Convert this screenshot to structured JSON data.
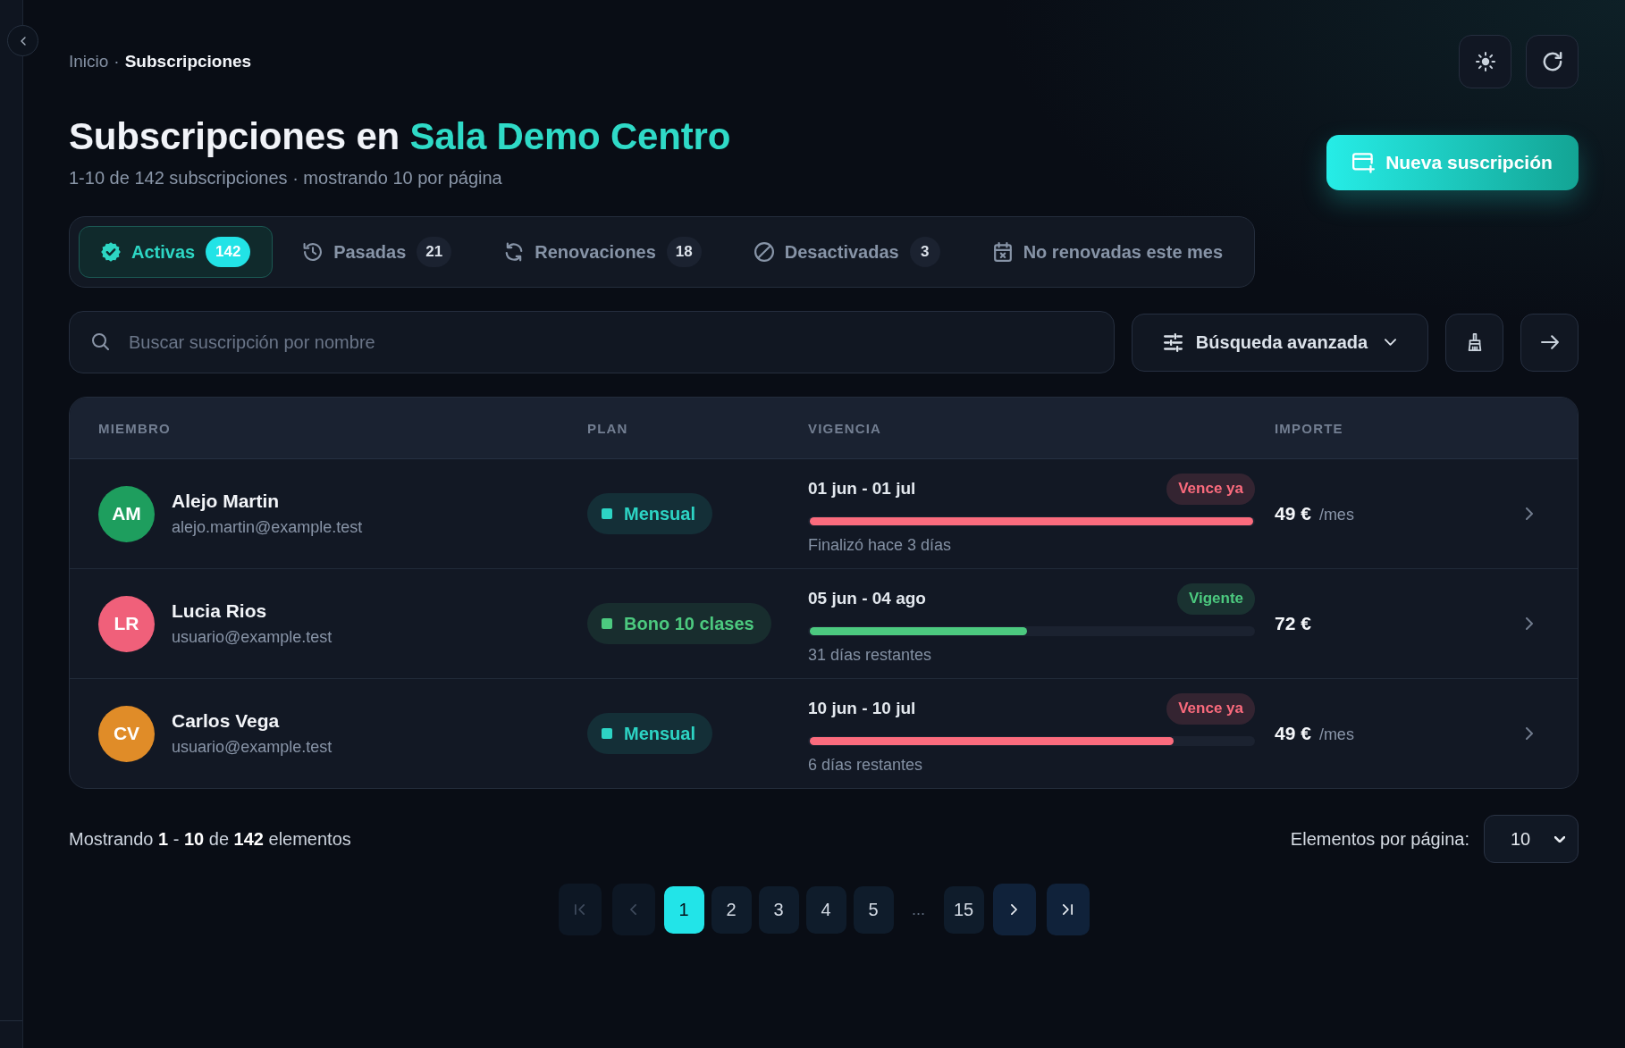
{
  "breadcrumb": {
    "separator": "·",
    "items": [
      {
        "label": "Inicio",
        "current": false
      },
      {
        "label": "Subscripciones",
        "current": true
      }
    ]
  },
  "header": {
    "title": "Subscripciones en",
    "title_highlight": "Sala Demo Centro",
    "subtitle": "1-10 de 142 subscripciones · mostrando 10 por página",
    "primary_button": "Nueva suscripción"
  },
  "tabs": [
    {
      "label": "Activas",
      "count": "142",
      "selected": true
    },
    {
      "label": "Pasadas",
      "count": "21",
      "selected": false
    },
    {
      "label": "Renovaciones",
      "count": "18",
      "selected": false
    },
    {
      "label": "Desactivadas",
      "count": "3",
      "selected": false
    },
    {
      "label": "No renovadas este mes",
      "selected": false
    }
  ],
  "search": {
    "placeholder": "Buscar suscripción por nombre"
  },
  "advanced_search": {
    "label": "Búsqueda avanzada"
  },
  "table": {
    "columns": [
      "MIEMBRO",
      "PLAN",
      "VIGENCIA",
      "IMPORTE"
    ],
    "rows": [
      {
        "avatar": {
          "initials": "AM",
          "color": "#1e9e5e"
        },
        "name": "Alejo Martin",
        "email": "alejo.martin@example.test",
        "plan": {
          "label": "Mensual",
          "color": "#2dd4c4"
        },
        "period": "01 jun - 01 jul",
        "status": {
          "label": "Vence ya",
          "color": "#fb6b7d"
        },
        "level": 1,
        "remaining": "Finalizó hace 3 días",
        "amount": "49 €",
        "unit": "/mes"
      },
      {
        "avatar": {
          "initials": "LR",
          "color": "#f0607a"
        },
        "name": "Lucia Rios",
        "email": "usuario@example.test",
        "plan": {
          "label": "Bono 10 clases",
          "color": "#4cc97f"
        },
        "period": "05 jun - 04 ago",
        "status": {
          "label": "Vigente",
          "color": "#4cc97f"
        },
        "level": 0.49,
        "remaining": "31 días restantes",
        "amount": "72 €"
      },
      {
        "avatar": {
          "initials": "CV",
          "color": "#e08c28"
        },
        "name": "Carlos Vega",
        "email": "usuario@example.test",
        "plan": {
          "label": "Mensual",
          "color": "#2dd4c4"
        },
        "period": "10 jun - 10 jul",
        "status": {
          "label": "Vence ya",
          "color": "#fb6b7d"
        },
        "level": 0.82,
        "remaining": "6 días restantes",
        "amount": "49 €",
        "unit": "/mes"
      }
    ]
  },
  "footer": {
    "summary": "Mostrando **1** - **10** de **142** elementos",
    "per_page_label": "Elementos por página:",
    "per_page_value": "10"
  },
  "pagination": {
    "nav": [
      {
        "kind": "first",
        "disabled": true
      },
      {
        "kind": "prev",
        "disabled": true
      },
      {
        "kind": "next",
        "disabled": false
      },
      {
        "kind": "last",
        "disabled": false
      }
    ],
    "pages": [
      {
        "kind": "page",
        "label": "1",
        "selected": true
      },
      {
        "kind": "page",
        "label": "2",
        "selected": false
      },
      {
        "kind": "page",
        "label": "3",
        "selected": false
      },
      {
        "kind": "page",
        "label": "4",
        "selected": false
      },
      {
        "kind": "page",
        "label": "5",
        "selected": false
      },
      {
        "kind": "gap",
        "label": "...",
        "selected": false
      },
      {
        "kind": "page",
        "label": "15",
        "selected": false
      }
    ]
  }
}
